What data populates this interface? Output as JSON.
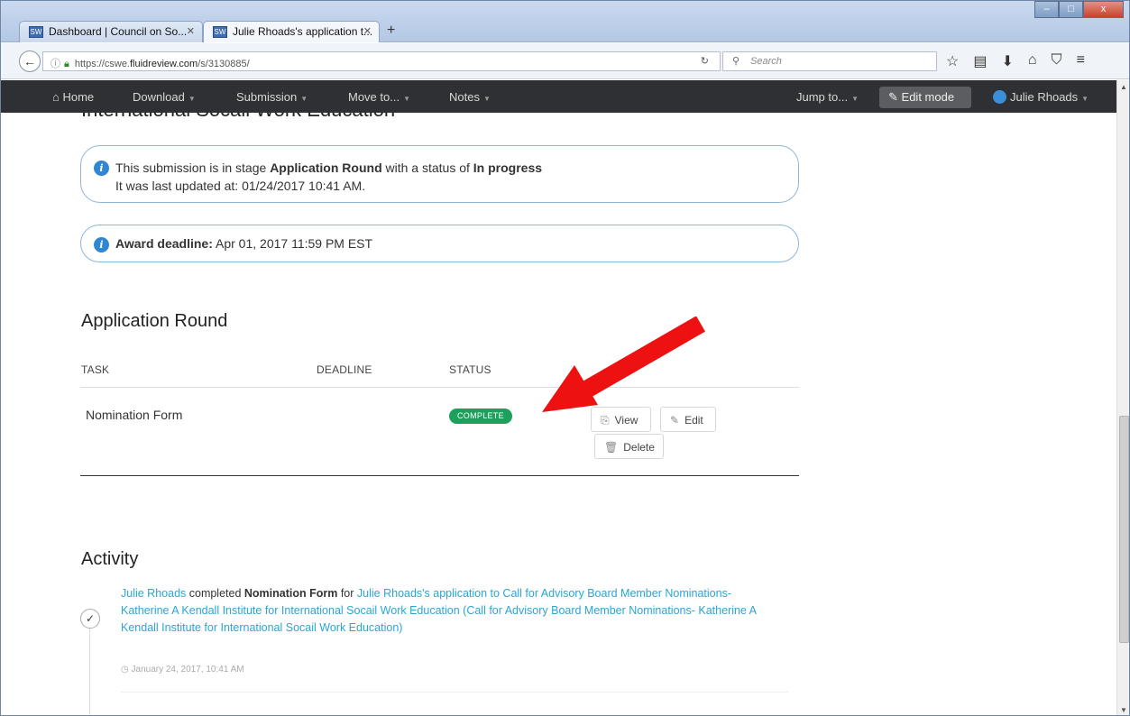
{
  "browser": {
    "tabs": [
      {
        "label": "Dashboard | Council on So...",
        "favicon": "SW"
      },
      {
        "label": "Julie Rhoads's application t...",
        "favicon": "SW"
      }
    ],
    "new_tab": "+",
    "url_prefix": "https://cswe.",
    "url_domain": "fluidreview.com",
    "url_path": "/s/3130885/",
    "search_placeholder": "Search",
    "window_buttons": [
      "–",
      "□",
      "x"
    ]
  },
  "header": {
    "home": "Home",
    "menus": [
      "Download",
      "Submission",
      "Move to...",
      "Notes"
    ],
    "jump": "Jump to...",
    "edit_mode": "Edit mode",
    "user": "Julie Rhoads"
  },
  "page": {
    "heading": "International Socail Work Education",
    "status": {
      "pre": "This submission is in stage ",
      "stage": "Application Round",
      "mid": " with a status of ",
      "state": "In progress",
      "updated": "It was last updated at: 01/24/2017 10:41 AM."
    },
    "deadline": {
      "label": "Award deadline:",
      "value": " Apr 01, 2017 11:59 PM EST"
    },
    "round": {
      "title": "Application Round",
      "columns": [
        "TASK",
        "DEADLINE",
        "STATUS"
      ],
      "task": "Nomination Form",
      "badge": "COMPLETE",
      "view": "View",
      "edit": "Edit",
      "delete": "Delete"
    },
    "activity": {
      "title": "Activity",
      "actor": "Julie Rhoads",
      "verb": " completed ",
      "form": "Nomination Form",
      "for": " for ",
      "link": "Julie Rhoads's application to Call for Advisory Board Member Nominations- Katherine A Kendall Institute for International Socail Work Education (Call for Advisory Board Member Nominations- Katherine A Kendall Institute for International Socail Work Education)",
      "time": "January 24, 2017, 10:41 AM"
    }
  },
  "colors": {
    "header_bg": "#2e3033",
    "link": "#2aa5d6",
    "badge": "#1ca05b",
    "arrow": "#ee1111"
  }
}
